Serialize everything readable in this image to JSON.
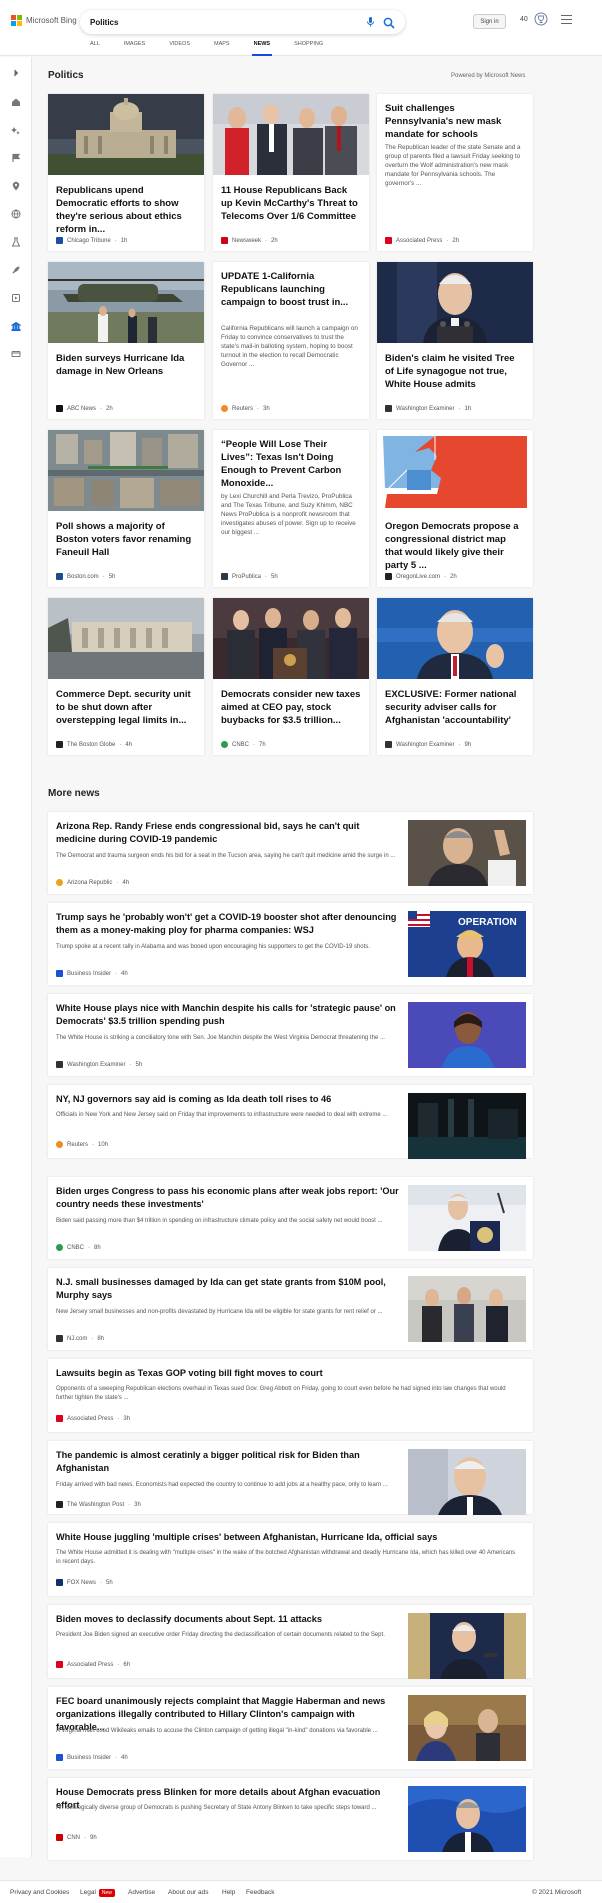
{
  "brand": {
    "name": "Microsoft Bing"
  },
  "search": {
    "query": "Politics"
  },
  "header": {
    "signin_label": "Sign in",
    "points": "40"
  },
  "tabs": [
    "ALL",
    "IMAGES",
    "VIDEOS",
    "MAPS",
    "NEWS",
    "SHOPPING"
  ],
  "section": {
    "title": "Politics",
    "powered_by": "Powered by Microsoft News"
  },
  "cards": [
    {
      "title": "Republicans upend Democratic efforts to show they're serious about ethics reform in...",
      "desc": "",
      "source": "Chicago Tribune",
      "age": "1h",
      "fav_color": "#1b4fa0"
    },
    {
      "title": "11 House Republicans Back up Kevin McCarthy's Threat to Telecoms Over 1/6 Committee",
      "desc": "",
      "source": "Newsweek",
      "age": "2h",
      "fav_color": "#d0021b"
    },
    {
      "title": "Suit challenges Pennsylvania's new mask mandate for schools",
      "desc": "The Republican leader of the state Senate and a group of parents filed a lawsuit Friday seeking to overturn the Wolf administration's new mask mandate for Pennsylvania schools. The governor's ...",
      "source": "Associated Press",
      "age": "2h",
      "fav_color": "#e0001b"
    },
    {
      "title": "Biden surveys Hurricane Ida damage in New Orleans",
      "desc": "",
      "source": "ABC News",
      "age": "2h",
      "fav_color": "#111111"
    },
    {
      "title": "UPDATE 1-California Republicans launching campaign to boost trust in...",
      "desc": "California Republicans will launch a campaign on Friday to convince conservatives to trust the state's mail-in balloting system, hoping to boost turnout in the election to recall Democratic Governor ...",
      "source": "Reuters",
      "age": "3h",
      "fav_color": "#f28b20"
    },
    {
      "title": "Biden's claim he visited Tree of Life synagogue not true, White House admits",
      "desc": "",
      "source": "Washington Examiner",
      "age": "1h",
      "fav_color": "#333333"
    },
    {
      "title": "Poll shows a majority of Boston voters favor renaming Faneuil Hall",
      "desc": "",
      "source": "Boston.com",
      "age": "5h",
      "fav_color": "#1a4e8a"
    },
    {
      "title": "“People Will Lose Their Lives”: Texas Isn't Doing Enough to Prevent Carbon Monoxide...",
      "desc": "by Lexi Churchill and Perla Trevizo, ProPublica and The Texas Tribune, and Suzy Khimm, NBC News ProPublica is a nonprofit newsroom that investigates abuses of power. Sign up to receive our biggest ...",
      "source": "ProPublica",
      "age": "5h",
      "fav_color": "#2a3a4a"
    },
    {
      "title": "Oregon Democrats propose a congressional district map that would likely give their party 5 ...",
      "desc": "",
      "source": "OregonLive.com",
      "age": "2h",
      "fav_color": "#222222"
    },
    {
      "title": "Commerce Dept. security unit to be shut down after overstepping legal limits in...",
      "desc": "",
      "source": "The Boston Globe",
      "age": "4h",
      "fav_color": "#222222"
    },
    {
      "title": "Democrats consider new taxes aimed at CEO pay, stock buybacks for $3.5 trillion...",
      "desc": "",
      "source": "CNBC",
      "age": "7h",
      "fav_color": "#2a9d4a"
    },
    {
      "title": "EXCLUSIVE: Former national security adviser calls for Afghanistan 'accountability'",
      "desc": "",
      "source": "Washington Examiner",
      "age": "9h",
      "fav_color": "#333333"
    }
  ],
  "more_news": {
    "title": "More news",
    "items": [
      {
        "title": "Arizona Rep. Randy Friese ends congressional bid, says he can't quit medicine during COVID-19 pandemic",
        "desc": "The Democrat and trauma surgeon ends his bid for a seat in the Tucson area, saying he can't quit medicine amid the surge in ...",
        "source": "Arizona Republic",
        "age": "4h",
        "fav_color": "#e8a31a",
        "has_image": true
      },
      {
        "title": "Trump says he 'probably won't' get a COVID-19 booster shot after denouncing them as a money-making ploy for pharma companies: WSJ",
        "desc": "Trump spoke at a recent rally in Alabama and was booed upon encouraging his supporters to get the COVID-19 shots.",
        "source": "Business Insider",
        "age": "4h",
        "fav_color": "#1d4fd8",
        "has_image": true,
        "image_text": "OPERATION"
      },
      {
        "title": "White House plays nice with Manchin despite his calls for 'strategic pause' on Democrats' $3.5 trillion spending push",
        "desc": "The White House is striking a conciliatory tone with Sen. Joe Manchin despite the West Virginia Democrat threatening the ...",
        "source": "Washington Examiner",
        "age": "5h",
        "fav_color": "#333333",
        "has_image": true
      },
      {
        "title": "NY, NJ governors say aid is coming as Ida death toll rises to 46",
        "desc": "Officials in New York and New Jersey said on Friday that improvements to infrastructure were needed to deal with extreme ...",
        "source": "Reuters",
        "age": "10h",
        "fav_color": "#f28b20",
        "has_image": true
      },
      {
        "title": "Biden urges Congress to pass his economic plans after weak jobs report: 'Our country needs these investments'",
        "desc": "Biden said passing more than $4 trillion in spending on infrastructure climate policy and the social safety net would boost ...",
        "source": "CNBC",
        "age": "8h",
        "fav_color": "#2a9d4a",
        "has_image": true
      },
      {
        "title": "N.J. small businesses damaged by Ida can get state grants from $10M pool, Murphy says",
        "desc": "New Jersey small businesses and non-profits devastated by Hurricane Ida will be eligible for state grants for rent relief or ...",
        "source": "NJ.com",
        "age": "8h",
        "fav_color": "#333333",
        "has_image": true
      },
      {
        "title": "Lawsuits begin as Texas GOP voting bill fight moves to court",
        "desc": "Opponents of a sweeping Republican elections overhaul in Texas sued Gov. Greg Abbott on Friday, going to court even before he had signed into law changes that would further tighten the state's ...",
        "source": "Associated Press",
        "age": "3h",
        "fav_color": "#e0001b",
        "has_image": false
      },
      {
        "title": "The pandemic is almost ceratinly a bigger political risk for Biden than Afghanistan",
        "desc": "Friday arrived with bad news. Economists had expected the country to continue to add jobs at a healthy pace, only to learn ...",
        "source": "The Washington Post",
        "age": "3h",
        "fav_color": "#222222",
        "has_image": true
      },
      {
        "title": "White House juggling 'multiple crises' between Afghanistan, Hurricane Ida, official says",
        "desc": "The White House admitted it is dealing with \"multiple crises\" in the wake of the botched Afghanistan withdrawal and deadly Hurricane Ida, which has killed over 40 Americans in recent days.",
        "source": "FOX News",
        "age": "5h",
        "fav_color": "#14306b",
        "has_image": false
      },
      {
        "title": "Biden moves to declassify documents about Sept. 11 attacks",
        "desc": "President Joe Biden signed an executive order Friday directing the declassification of certain documents related to the Sept.",
        "source": "Associated Press",
        "age": "6h",
        "fav_color": "#e0001b",
        "has_image": true
      },
      {
        "title": "FEC board unanimously rejects complaint that Maggie Haberman and news organizations illegally contributed to Hillary Clinton's campaign with favorable...",
        "desc": "A Virginia man used Wikileaks emails to accuse the Clinton campaign of getting illegal \"in-kind\" donations via favorable ...",
        "source": "Business Insider",
        "age": "4h",
        "fav_color": "#1d4fd8",
        "has_image": true
      },
      {
        "title": "House Democrats press Blinken for more details about Afghan evacuation effort",
        "desc": "An ideologically diverse group of Democrats is pushing Secretary of State Antony Blinken to take specific steps toward ...",
        "source": "CNN",
        "age": "9h",
        "fav_color": "#cc0000",
        "has_image": true
      }
    ]
  },
  "footer": {
    "links": [
      "Privacy and Cookies",
      "Legal",
      "Advertise",
      "About our ads",
      "Help",
      "Feedback"
    ],
    "new_badge": "New",
    "copyright": "© 2021 Microsoft"
  }
}
